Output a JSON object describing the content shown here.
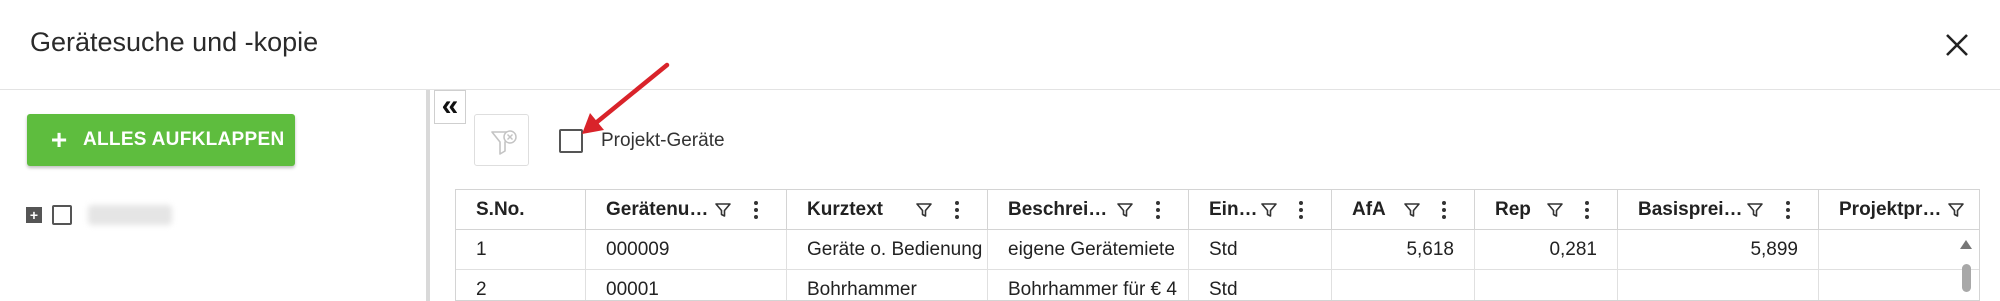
{
  "dialog": {
    "title": "Gerätesuche und -kopie"
  },
  "left_pane": {
    "expand_all_label": "ALLES AUFKLAPPEN",
    "tree": [
      {
        "toggle": "+"
      }
    ]
  },
  "toolbar": {
    "project_devices_label": "Projekt-Geräte"
  },
  "grid": {
    "columns": [
      {
        "label": "S.No."
      },
      {
        "label": "Gerätenu…"
      },
      {
        "label": "Kurztext"
      },
      {
        "label": "Beschrei…"
      },
      {
        "label": "Ein…"
      },
      {
        "label": "AfA"
      },
      {
        "label": "Rep"
      },
      {
        "label": "Basisprei…"
      },
      {
        "label": "Projektpr…"
      }
    ],
    "rows": [
      [
        "1",
        "000009",
        "Geräte o. Bedienung",
        "eigene Gerätemiete",
        "Std",
        "5,618",
        "0,281",
        "5,899",
        ""
      ],
      [
        "2",
        "00001",
        "Bohrhammer",
        "Bohrhammer für € 4",
        "Std",
        "",
        "",
        "",
        ""
      ]
    ]
  },
  "colors": {
    "accent_green": "#5ebd3e",
    "annotation_arrow": "#d9232a"
  }
}
